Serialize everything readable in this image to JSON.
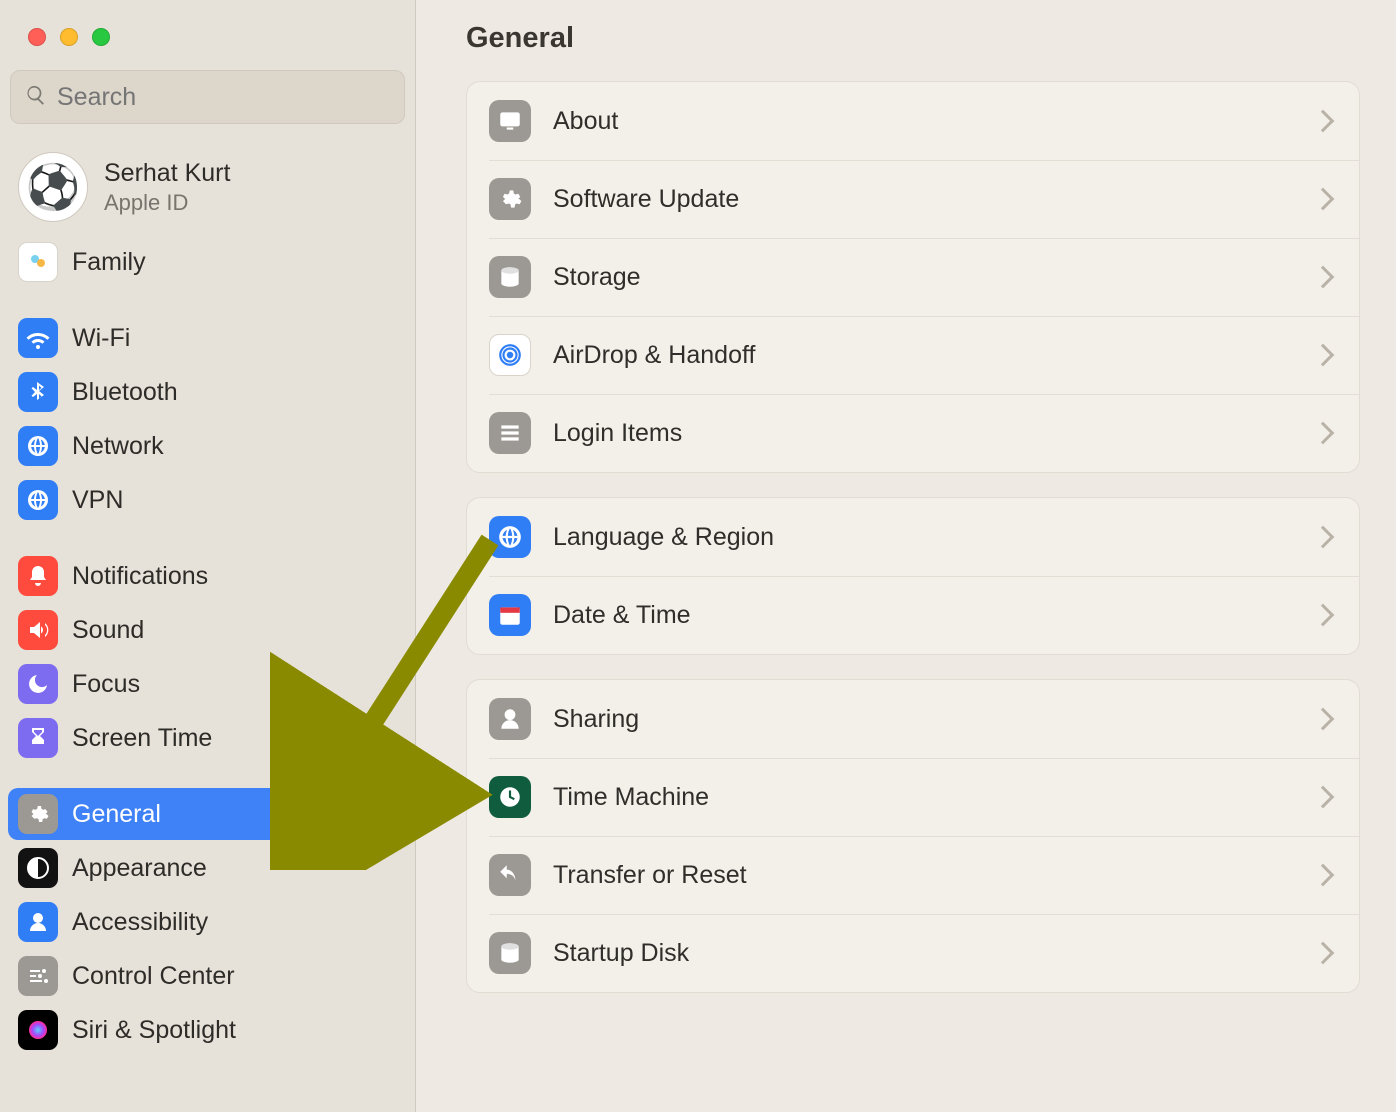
{
  "search": {
    "placeholder": "Search"
  },
  "account": {
    "name": "Serhat Kurt",
    "subtitle": "Apple ID"
  },
  "header": {
    "title": "General"
  },
  "sidebar_top": [
    {
      "id": "family",
      "label": "Family",
      "icon": "family",
      "bg": "#ffffff"
    }
  ],
  "sidebar_network": [
    {
      "id": "wifi",
      "label": "Wi-Fi",
      "icon": "wifi",
      "bg": "#2f7ef6"
    },
    {
      "id": "bluetooth",
      "label": "Bluetooth",
      "icon": "bluetooth",
      "bg": "#2f7ef6"
    },
    {
      "id": "network",
      "label": "Network",
      "icon": "globe",
      "bg": "#2f7ef6"
    },
    {
      "id": "vpn",
      "label": "VPN",
      "icon": "globe",
      "bg": "#2f7ef6"
    }
  ],
  "sidebar_activity": [
    {
      "id": "notifications",
      "label": "Notifications",
      "icon": "bell",
      "bg": "#ff4b3e"
    },
    {
      "id": "sound",
      "label": "Sound",
      "icon": "speaker",
      "bg": "#ff4b3e"
    },
    {
      "id": "focus",
      "label": "Focus",
      "icon": "moon",
      "bg": "#7d6cf0"
    },
    {
      "id": "screentime",
      "label": "Screen Time",
      "icon": "hourglass",
      "bg": "#7d6cf0"
    }
  ],
  "sidebar_system": [
    {
      "id": "general",
      "label": "General",
      "icon": "gear",
      "bg": "#9c9893",
      "selected": true
    },
    {
      "id": "appearance",
      "label": "Appearance",
      "icon": "contrast",
      "bg": "#121212"
    },
    {
      "id": "accessibility",
      "label": "Accessibility",
      "icon": "person",
      "bg": "#2f7ef6"
    },
    {
      "id": "controlcenter",
      "label": "Control Center",
      "icon": "sliders",
      "bg": "#9c9893"
    },
    {
      "id": "siri",
      "label": "Siri & Spotlight",
      "icon": "siri",
      "bg": "#000000"
    }
  ],
  "main_groups": [
    [
      {
        "id": "about",
        "label": "About",
        "icon": "display",
        "bg": "#9c9893"
      },
      {
        "id": "update",
        "label": "Software Update",
        "icon": "gear",
        "bg": "#9c9893"
      },
      {
        "id": "storage",
        "label": "Storage",
        "icon": "disk",
        "bg": "#9c9893"
      },
      {
        "id": "airdrop",
        "label": "AirDrop & Handoff",
        "icon": "airdrop",
        "bg": "#ffffff"
      },
      {
        "id": "login",
        "label": "Login Items",
        "icon": "list",
        "bg": "#9c9893"
      }
    ],
    [
      {
        "id": "language",
        "label": "Language & Region",
        "icon": "globe",
        "bg": "#2f7ef6"
      },
      {
        "id": "datetime",
        "label": "Date & Time",
        "icon": "calendar",
        "bg": "#2f7ef6"
      }
    ],
    [
      {
        "id": "sharing",
        "label": "Sharing",
        "icon": "person",
        "bg": "#9c9893"
      },
      {
        "id": "tm",
        "label": "Time Machine",
        "icon": "clock",
        "bg": "#0f5c3f"
      },
      {
        "id": "transfer",
        "label": "Transfer or Reset",
        "icon": "undo",
        "bg": "#9c9893"
      },
      {
        "id": "startup",
        "label": "Startup Disk",
        "icon": "disk",
        "bg": "#9c9893"
      }
    ]
  ],
  "annotation": {
    "kind": "arrow",
    "target": "general"
  }
}
